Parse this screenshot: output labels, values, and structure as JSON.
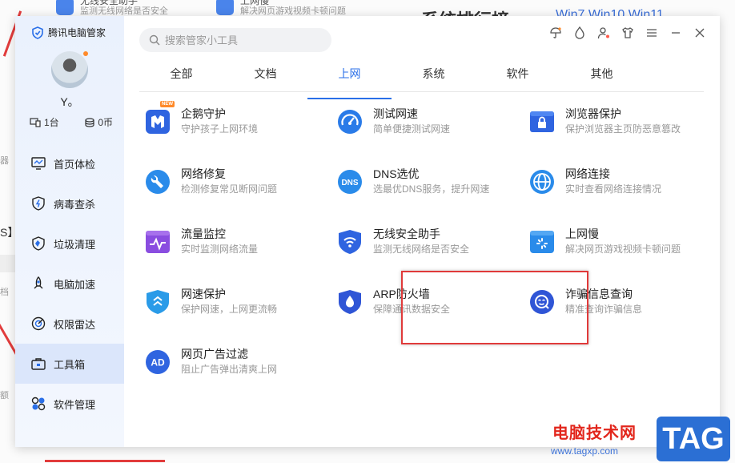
{
  "background": {
    "top_items": [
      {
        "title": "无线安全助手",
        "desc": "监测无线网络是否安全"
      },
      {
        "title": "上网慢",
        "desc": "解决网页游戏视频卡顿问题"
      }
    ],
    "heading": "系统排行榜",
    "link": "Win7 Win10 Win11",
    "side_texts": [
      "器",
      "S】",
      "档",
      "额"
    ]
  },
  "app": {
    "brand": "腾讯电脑管家",
    "user": {
      "name": "Y。",
      "devices": "1台",
      "coins": "0币"
    },
    "nav": [
      {
        "label": "首页体检",
        "icon": "monitor-icon"
      },
      {
        "label": "病毒查杀",
        "icon": "shield-bolt-icon"
      },
      {
        "label": "垃圾清理",
        "icon": "broom-icon"
      },
      {
        "label": "电脑加速",
        "icon": "rocket-icon"
      },
      {
        "label": "权限雷达",
        "icon": "radar-icon"
      },
      {
        "label": "工具箱",
        "icon": "toolbox-icon",
        "active": true
      },
      {
        "label": "软件管理",
        "icon": "apps-icon"
      }
    ],
    "search_placeholder": "搜索管家小工具",
    "tabs": [
      "全部",
      "文档",
      "上网",
      "系统",
      "软件",
      "其他"
    ],
    "active_tab": "上网",
    "tools": [
      {
        "name": "企鹅守护",
        "desc": "守护孩子上网环境",
        "icon": "penguin-guard-icon",
        "badge": "NEW"
      },
      {
        "name": "测试网速",
        "desc": "简单便捷测试网速",
        "icon": "speedometer-icon"
      },
      {
        "name": "浏览器保护",
        "desc": "保护浏览器主页防恶意篡改",
        "icon": "browser-lock-icon"
      },
      {
        "name": "网络修复",
        "desc": "检测修复常见断网问题",
        "icon": "wrench-icon"
      },
      {
        "name": "DNS选优",
        "desc": "选最优DNS服务，提升网速",
        "icon": "dns-icon",
        "icon_text": "DNS"
      },
      {
        "name": "网络连接",
        "desc": "实时查看网络连接情况",
        "icon": "globe-icon"
      },
      {
        "name": "流量监控",
        "desc": "实时监测网络流量",
        "icon": "traffic-monitor-icon"
      },
      {
        "name": "无线安全助手",
        "desc": "监测无线网络是否安全",
        "icon": "wifi-shield-icon"
      },
      {
        "name": "上网慢",
        "desc": "解决网页游戏视频卡顿问题",
        "icon": "slow-network-icon"
      },
      {
        "name": "网速保护",
        "desc": "保护网速，上网更流畅",
        "icon": "speed-shield-icon"
      },
      {
        "name": "ARP防火墙",
        "desc": "保障通讯数据安全",
        "icon": "arp-firewall-icon"
      },
      {
        "name": "诈骗信息查询",
        "desc": "精准查询诈骗信息",
        "icon": "fraud-search-icon"
      },
      {
        "name": "网页广告过滤",
        "desc": "阻止广告弹出清爽上网",
        "icon": "ad-filter-icon",
        "icon_text": "AD"
      }
    ]
  },
  "watermark": {
    "site_name": "电脑技术网",
    "url": "www.tagxp.com",
    "tag": "TAG"
  },
  "colors": {
    "accent": "#2a6fe8",
    "highlight": "#e03a3a",
    "sidebar_active": "#dbe6fb"
  }
}
